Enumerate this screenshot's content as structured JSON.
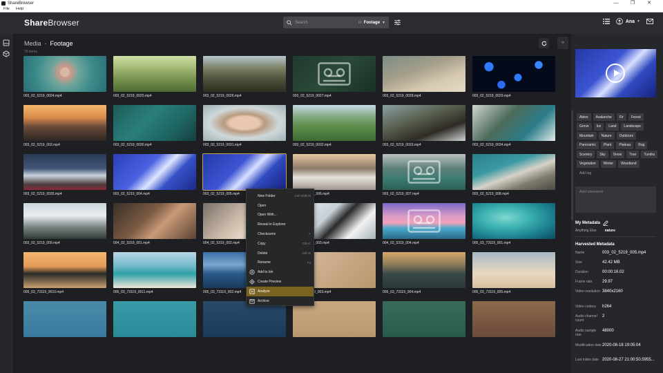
{
  "window": {
    "title": "ShareBrowser",
    "controls": [
      "—",
      "❐",
      "✕"
    ]
  },
  "menubar": {
    "items": [
      "File",
      "Help"
    ]
  },
  "header": {
    "logo_bold": "Share",
    "logo_light": "Browser",
    "search": {
      "placeholder": "Search",
      "in_label": "in",
      "scope": "Footage"
    },
    "user": "Ana"
  },
  "main": {
    "breadcrumb": {
      "root": "Media",
      "separator": "-",
      "current": "Footage"
    },
    "count": "76 items",
    "tiles": [
      {
        "name": "003_02_5219_0024.mp4",
        "bg": "radial-gradient(circle at 50% 45%, #d9b8a6 0 10%, #c89a8a 11% 14%, #6fa59c 30%, #3e8c8c 60%, #2a6f74 100%)"
      },
      {
        "name": "003_02_5219_0025.mp4",
        "bg": "linear-gradient(180deg, #cfe0a8 0%, #a8bd7a 30%, #7d9855 60%, #4f6a32 100%)"
      },
      {
        "name": "003_02_5219_0026.mp4",
        "bg": "linear-gradient(180deg, #b6c6cf 0%, #7a8062 35%, #4c513a 65%, #2d2f22 100%)"
      },
      {
        "name": "003_02_5219_0027.mp4",
        "bg": "linear-gradient(135deg, #1f3a30 0%, #2c4a38 50%, #183024 100%)",
        "tape": true
      },
      {
        "name": "003_02_5219_0028.mp4",
        "bg": "linear-gradient(160deg, #7a8f84 0%, #a59e8a 40%, #d6c9b0 70%, #e5dac6 100%)"
      },
      {
        "name": "003_02_5219_0029.mp4",
        "bg": "radial-gradient(circle at 20% 30%, #2f7bff 0 6%, transparent 7%), radial-gradient(circle at 55% 60%, #2f7bff 0 7%, transparent 8%), radial-gradient(circle at 80% 25%, #3a86ff 0 5%, transparent 6%), radial-gradient(circle at 35% 80%, #2a6df0 0 6%, transparent 7%), #050a1a"
      },
      {
        "name": "003_02_5219_003.mp4",
        "bg": "linear-gradient(180deg, #f5b86a 0%, #d98a4a 35%, #6b4b3a 60%, #2d2623 100%)"
      },
      {
        "name": "003_02_5219_0030.mp4",
        "bg": "linear-gradient(135deg, #1d5b58 0%, #2a7f7b 40%, #1e6663 70%, #153f3e 100%)"
      },
      {
        "name": "003_02_5219_0031.mp4",
        "bg": "radial-gradient(ellipse at 50% 50%, #e8c8b0 0 25%, #b89a80 35%, #cfd8da 60%, #9fb1b5 100%)"
      },
      {
        "name": "003_02_5219_0032.mp4",
        "bg": "linear-gradient(180deg, #c7d9e5 0%, #7fa57a 35%, #5e8c4a 60%, #3d6b32 100%)"
      },
      {
        "name": "003_02_5219_0033.mp4",
        "bg": "linear-gradient(160deg, #8aa0a5 0%, #59604f 40%, #2e2b25 70%, #cfd5d4 100%)"
      },
      {
        "name": "003_02_5219_0034.mp4",
        "bg": "linear-gradient(135deg, #cfd6d2 0%, #4d6b5a 40%, #2b7c8a 70%, #e2ece9 100%)"
      },
      {
        "name": "003_02_5219_0035.mp4",
        "bg": "linear-gradient(180deg, #2a3a55 0%, #415576 40%, #c9d2dc 60%, #4b3a3a 85%, #8a2a3a 100%)"
      },
      {
        "name": "003_02_5219_004.mp4",
        "bg": "linear-gradient(135deg, #2b3fb8 0%, #4a62e0 40%, #dfe6ff 55%, #3550c8 70%, #1c2a8a 100%)"
      },
      {
        "name": "003_02_5219_005.mp4",
        "bg": "linear-gradient(135deg, #243aa8 0%, #3c54d2 40%, #d8e0ff 55%, #304ac0 70%, #18237e 100%)",
        "selected": true
      },
      {
        "name": "003_02_5219_006.mp4",
        "bg": "linear-gradient(180deg, #e8c7a0 0%, #8c7a6a 40%, #e6e2dc 65%, #a09890 100%)"
      },
      {
        "name": "003_02_5219_007.mp4",
        "bg": "linear-gradient(180deg, #b9c3c0 0%, #5f807a 40%, #3a7a70 70%, #2d5f55 100%)",
        "tape": true
      },
      {
        "name": "003_02_5219_008.mp4",
        "bg": "linear-gradient(160deg, #2b7e8a 0%, #3a9aa3 35%, #d6d2c8 55%, #7f7a6e 75%, #4a4a40 100%)"
      },
      {
        "name": "003_02_5219_009.mp4",
        "bg": "linear-gradient(180deg, #c8d6dc 0%, #e9edf0 35%, #7f8a88 65%, #2f3a34 100%)"
      },
      {
        "name": "004_02_5319_001.mp4",
        "bg": "linear-gradient(135deg, #3a3028 0%, #7a5a44 40%, #c99a78 60%, #5a4232 100%)"
      },
      {
        "name": "004_02_5319_002.mp4",
        "bg": "linear-gradient(135deg, #7a7068 0%, #c8b8a8 40%, #e4d6c6 60%, #9a8a7a 100%)"
      },
      {
        "name": "004_02_5319_003.mp4",
        "bg": "linear-gradient(135deg, #e8eef2 0%, #c6d0d6 40%, #2a2a2a 55%, #f2f2f2 75%, #a8b2b8 100%)"
      },
      {
        "name": "004_02_5319_004.mp4",
        "bg": "linear-gradient(180deg, #7a6ac8 0%, #d89ac8 35%, #f2a0b8 55%, #4aa8c8 70%, #2a6a8a 100%)",
        "tape": true
      },
      {
        "name": "005_03_73119_001.mp4",
        "bg": "radial-gradient(ellipse at 40% 40%, #7fd8d0 0%, #3ab0b0 35%, #1a7a8a 70%, #0e4a5e 100%)"
      },
      {
        "name": "005_03_73119_0010.mp4",
        "bg": "linear-gradient(180deg, #f2b870 0%, #e39a58 40%, #2a2a28 60%, #c8a070 100%)"
      },
      {
        "name": "005_03_73119_0011.mp4",
        "bg": "linear-gradient(180deg, #bcd8e6 0%, #6fb8c8 40%, #2fa0a8 60%, #f0e8d8 100%)"
      },
      {
        "name": "005_03_73119_002.mp4",
        "bg": "linear-gradient(180deg, #3a6fa8 0%, #7aa8d0 35%, #2a5a8a 60%, #1a3a5a 100%)"
      },
      {
        "name": "005_03_73119_003.mp4",
        "bg": "linear-gradient(135deg, #d8bfa0 0%, #c8a886 50%, #b8966e 100%)"
      },
      {
        "name": "005_03_73119_004.mp4",
        "bg": "linear-gradient(180deg, #d8a868 0%, #8a7a5a 35%, #3a4a4a 60%, #2a3a3a 100%)"
      },
      {
        "name": "005_03_73119_005.mp4",
        "bg": "linear-gradient(180deg, #a8b8c8 0%, #d8d0c0 45%, #e8d8c0 60%, #d8c0a0 100%)"
      },
      {
        "name": "",
        "bg": "linear-gradient(180deg, #4a8aa8 0%, #3a7aa0 100%)"
      },
      {
        "name": "",
        "bg": "linear-gradient(180deg, #3a9aa8 0%, #2a8a98 100%)"
      },
      {
        "name": "",
        "bg": "linear-gradient(180deg, #2a4a6a 0%, #1a3a5a 100%)"
      },
      {
        "name": "",
        "bg": "linear-gradient(180deg, #c8a880 0%, #b89870 100%)"
      },
      {
        "name": "",
        "bg": "linear-gradient(180deg, #3a6a5a 0%, #2a5a4a 100%)"
      },
      {
        "name": "",
        "bg": "linear-gradient(180deg, #8a6a4a 0%, #6a4a3a 100%)"
      }
    ]
  },
  "context_menu": {
    "items": [
      {
        "label": "New Folder",
        "shortcut": "Ctrl+Shift+N"
      },
      {
        "label": "Open",
        "shortcut": ""
      },
      {
        "label": "Open With...",
        "shortcut": ""
      },
      {
        "label": "Reveal in Explorer",
        "shortcut": ""
      },
      {
        "label": "Checksums",
        "shortcut": "",
        "submenu": true
      },
      {
        "label": "Copy",
        "shortcut": "Ctrl+C"
      },
      {
        "label": "Delete",
        "shortcut": "Ctrl+D"
      },
      {
        "label": "Rename",
        "shortcut": "F2"
      },
      {
        "label": "Add to bin",
        "shortcut": "",
        "icon": "bin-icon"
      },
      {
        "label": "Create Preview",
        "shortcut": "",
        "icon": "preview-icon"
      },
      {
        "label": "Analyze",
        "shortcut": "",
        "icon": "analyze-icon",
        "highlighted": true
      },
      {
        "label": "Archive",
        "shortcut": "",
        "icon": "archive-icon"
      }
    ]
  },
  "panel": {
    "tags": [
      "Abies",
      "Avalanche",
      "Fir",
      "Forest",
      "Grove",
      "Ice",
      "Land",
      "Landscape",
      "Mountain",
      "Nature",
      "Outdoors",
      "Panoramic",
      "Plant",
      "Plateau",
      "Rug",
      "Scenery",
      "Sky",
      "Snow",
      "Tree",
      "Tundra",
      "Vegetation",
      "Winter",
      "Woodland"
    ],
    "add_tag": "Add tag",
    "comment_placeholder": "Add comment",
    "my_metadata_title": "My Metadata",
    "my_metadata": {
      "key": "Anything Else",
      "value": "nature"
    },
    "harvested_title": "Harvested Metadata",
    "harvested": [
      {
        "k": "Name",
        "v": "003_02_5219_005.mp4"
      },
      {
        "k": "Size",
        "v": "42.42 MB"
      },
      {
        "k": "Duration",
        "v": "00:00:16.02"
      },
      {
        "k": "Frame rate",
        "v": "29.97"
      },
      {
        "k": "Video resolution",
        "v": "3840x2160"
      },
      {
        "k": "Video codecs",
        "v": "h264"
      },
      {
        "k": "Audio channel count",
        "v": "2"
      },
      {
        "k": "Audio sample rate",
        "v": "48000"
      },
      {
        "k": "Modification date",
        "v": "2020-08-18 19:05:04"
      },
      {
        "k": "Last index date",
        "v": "2020-08-27 21:00:50.5955..."
      }
    ]
  }
}
